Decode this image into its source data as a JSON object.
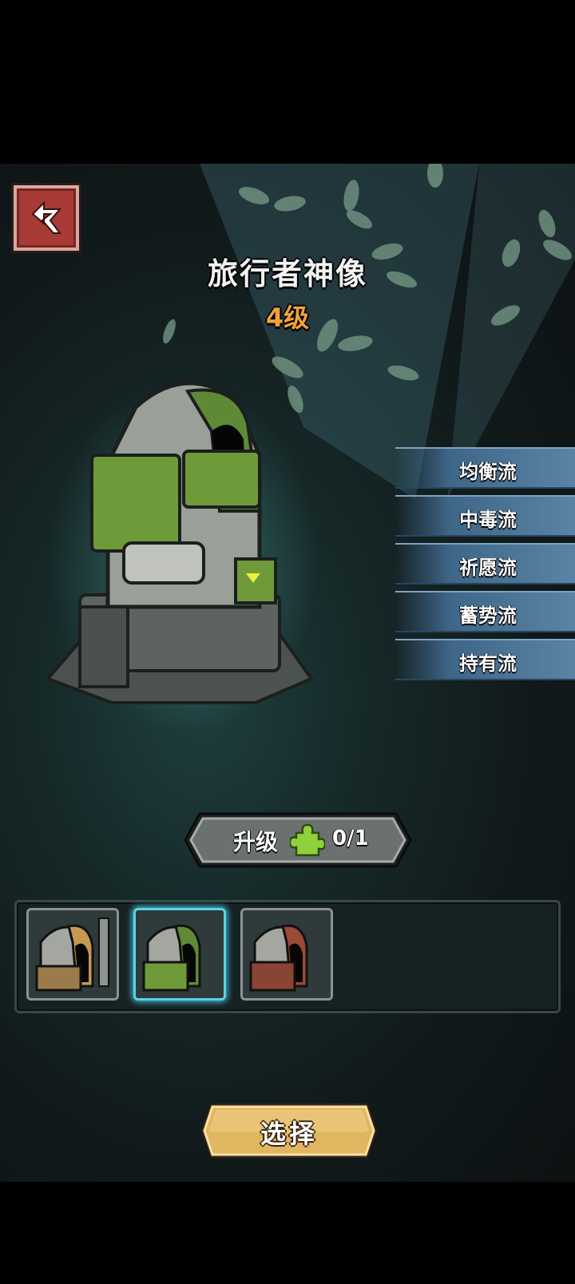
{
  "header": {
    "title": "旅行者神像",
    "level": "4级"
  },
  "style_tabs": [
    {
      "label": "均衡流"
    },
    {
      "label": "中毒流"
    },
    {
      "label": "祈愿流"
    },
    {
      "label": "蓄势流"
    },
    {
      "label": "持有流"
    }
  ],
  "upgrade": {
    "label": "升级",
    "count": "0/1"
  },
  "skins": [
    {
      "name": "golden-statue-skin",
      "selected": false
    },
    {
      "name": "green-statue-skin",
      "selected": true
    },
    {
      "name": "red-statue-skin",
      "selected": false
    }
  ],
  "actions": {
    "select_label": "选择"
  },
  "colors": {
    "accent_level": "#f2a23a",
    "back_button": "#a83a35",
    "tab": "#5a83a6",
    "selected_border": "#5ed1e6",
    "select_button": "#e0b660"
  }
}
